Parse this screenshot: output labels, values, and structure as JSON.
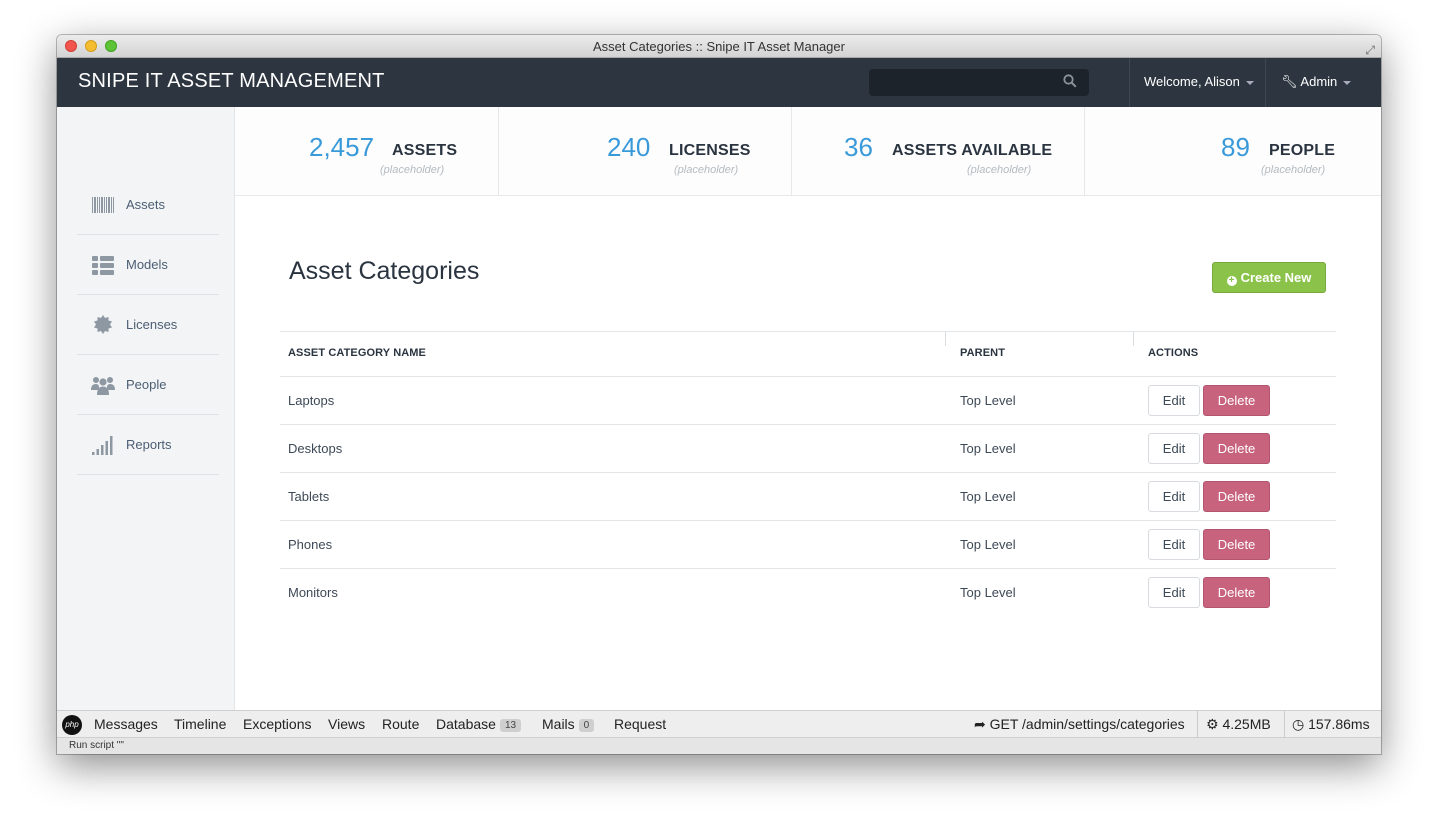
{
  "window": {
    "title": "Asset Categories :: Snipe IT Asset Manager"
  },
  "navbar": {
    "brand": "SNIPE IT ASSET MANAGEMENT",
    "search_value": "",
    "welcome": "Welcome, Alison",
    "admin": "Admin"
  },
  "sidebar": {
    "items": [
      {
        "label": "Assets",
        "icon": "barcode-icon"
      },
      {
        "label": "Models",
        "icon": "list-icon"
      },
      {
        "label": "Licenses",
        "icon": "certificate-icon"
      },
      {
        "label": "People",
        "icon": "people-icon"
      },
      {
        "label": "Reports",
        "icon": "signal-bars-icon"
      }
    ]
  },
  "stats": [
    {
      "value": "2,457",
      "label": "ASSETS",
      "sub": "(placeholder)"
    },
    {
      "value": "240",
      "label": "LICENSES",
      "sub": "(placeholder)"
    },
    {
      "value": "36",
      "label": "ASSETS AVAILABLE",
      "sub": "(placeholder)"
    },
    {
      "value": "89",
      "label": "PEOPLE",
      "sub": "(placeholder)"
    }
  ],
  "main": {
    "title": "Asset Categories",
    "create_label": "Create New"
  },
  "table": {
    "headers": [
      "ASSET CATEGORY NAME",
      "PARENT",
      "ACTIONS"
    ],
    "edit_label": "Edit",
    "delete_label": "Delete",
    "rows": [
      {
        "name": "Laptops",
        "parent": "Top Level"
      },
      {
        "name": "Desktops",
        "parent": "Top Level"
      },
      {
        "name": "Tablets",
        "parent": "Top Level"
      },
      {
        "name": "Phones",
        "parent": "Top Level"
      },
      {
        "name": "Monitors",
        "parent": "Top Level"
      }
    ]
  },
  "debugbar": {
    "messages": "Messages",
    "timeline": "Timeline",
    "exceptions": "Exceptions",
    "views": "Views",
    "route": "Route",
    "database": "Database",
    "database_count": "13",
    "mails": "Mails",
    "mails_count": "0",
    "request": "Request",
    "route_value": "GET /admin/settings/categories",
    "memory": "4.25MB",
    "time": "157.86ms"
  },
  "statusbar": {
    "text": "Run script \"\""
  },
  "colors": {
    "navbar": "#2d3640",
    "accent": "#3a9ad9",
    "create": "#8bc34a",
    "delete": "#c8637e"
  }
}
